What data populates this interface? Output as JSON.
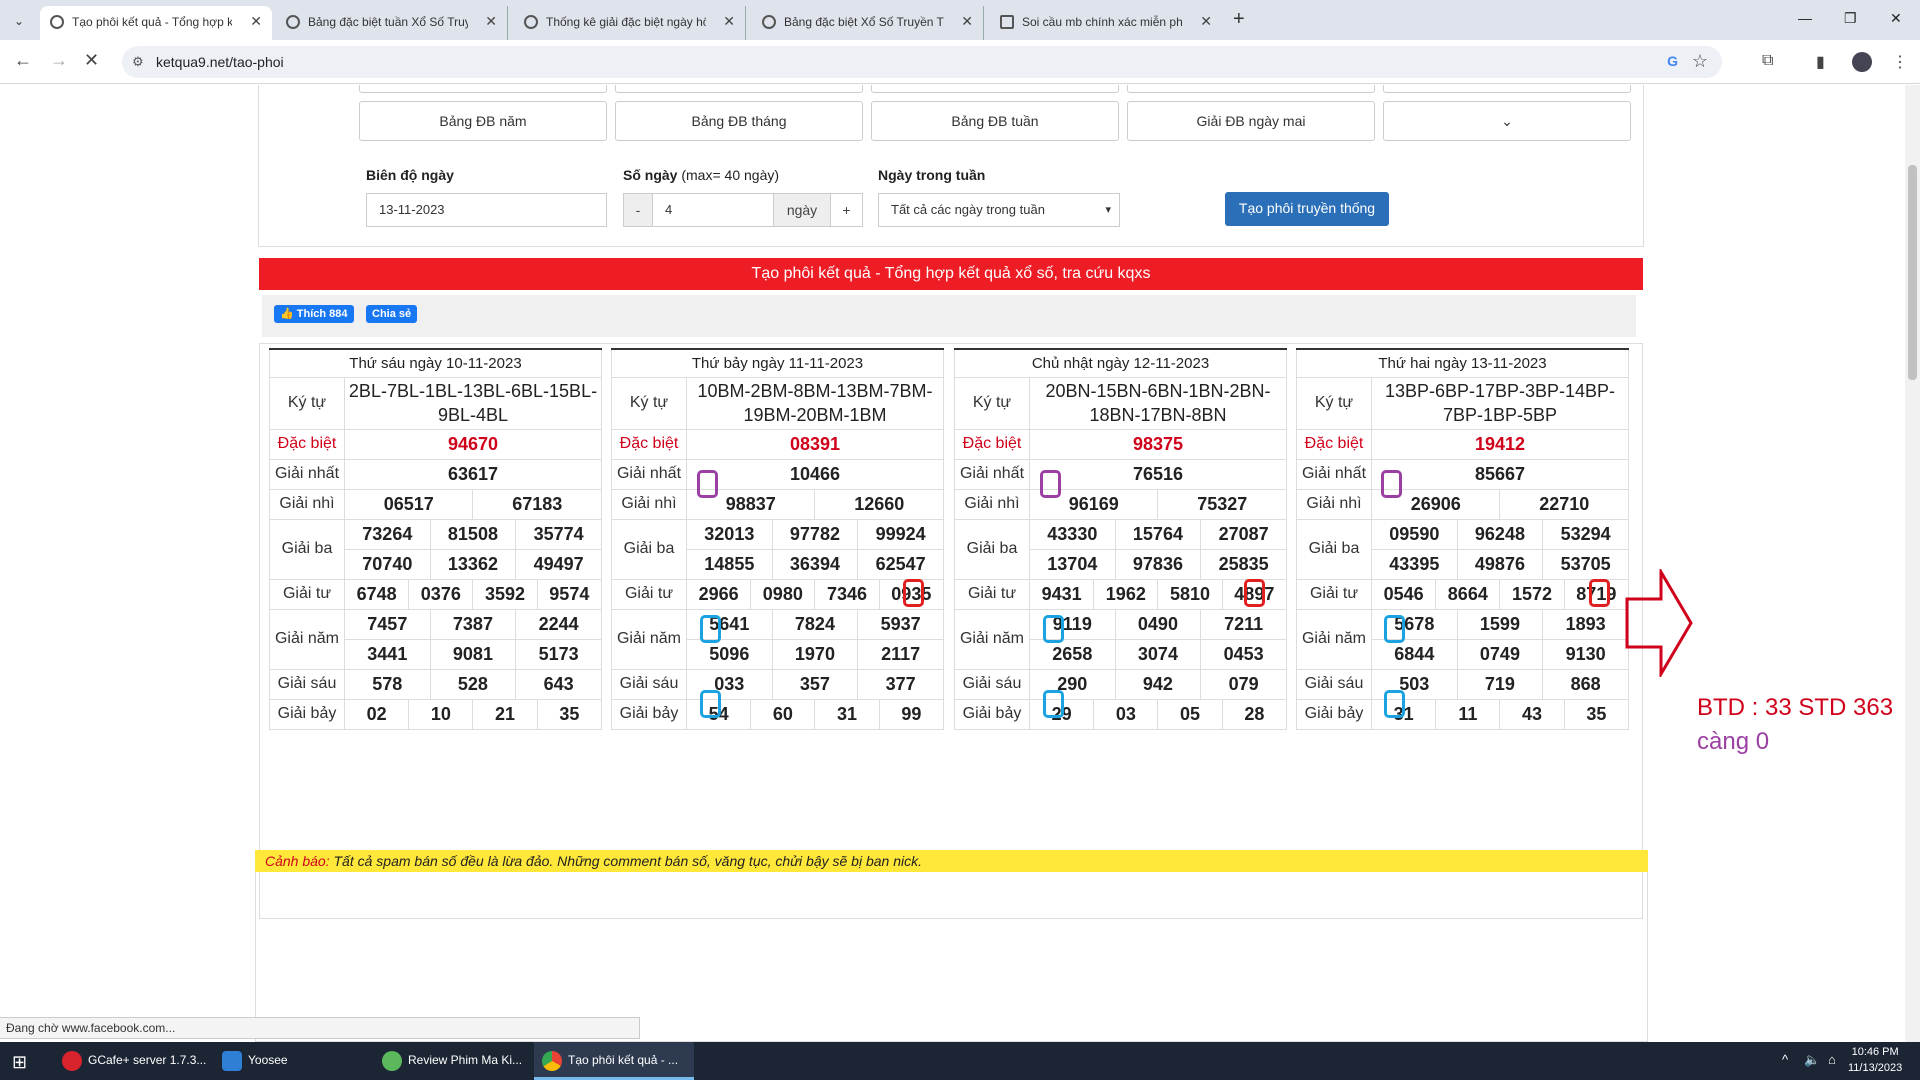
{
  "browser": {
    "tabs": [
      {
        "title": "Tạo phôi kết quả - Tổng hợp kết quả"
      },
      {
        "title": "Bảng đặc biệt tuần Xổ Số Truyền Thống"
      },
      {
        "title": "Thống kê giải đặc biệt ngày hôm nay"
      },
      {
        "title": "Bảng đặc biệt Xổ Số Truyền Thống"
      },
      {
        "title": "Soi cầu mb chính xác miễn phí"
      }
    ],
    "url": "ketqua9.net/tao-phoi"
  },
  "quick_buttons": [
    "Bảng ĐB năm",
    "Bảng ĐB tháng",
    "Bảng ĐB tuần",
    "Giải ĐB ngày mai"
  ],
  "form": {
    "date_label": "Biên độ ngày",
    "date_value": "13-11-2023",
    "days_label": "Số ngày",
    "days_hint": "(max= 40 ngày)",
    "days_minus": "-",
    "days_value": "4",
    "days_unit": "ngày",
    "days_plus": "+",
    "weekday_label": "Ngày trong tuần",
    "weekday_value": "Tất cả các ngày trong tuần",
    "submit": "Tạo phôi truyền thống"
  },
  "banner": "Tạo phôi kết quả - Tổng hợp kết quả xổ số, tra cứu kqxs",
  "share": {
    "like": "Thích 884",
    "share": "Chia sẻ"
  },
  "labels": {
    "kytu": "Ký tự",
    "db": "Đặc biệt",
    "g1": "Giải nhất",
    "g2": "Giải nhì",
    "g3": "Giải ba",
    "g4": "Giải tư",
    "g5": "Giải năm",
    "g6": "Giải sáu",
    "g7": "Giải bảy"
  },
  "results": [
    {
      "header": "Thứ sáu ngày 10-11-2023",
      "kytu": "2BL-7BL-1BL-13BL-6BL-15BL-9BL-4BL",
      "db": "94670",
      "g1": "63617",
      "g2": [
        "06517",
        "67183"
      ],
      "g3": [
        "73264",
        "81508",
        "35774",
        "70740",
        "13362",
        "49497"
      ],
      "g4": [
        "6748",
        "0376",
        "3592",
        "9574"
      ],
      "g5": [
        "7457",
        "7387",
        "2244",
        "3441",
        "9081",
        "5173"
      ],
      "g6": [
        "578",
        "528",
        "643"
      ],
      "g7": [
        "02",
        "10",
        "21",
        "35"
      ]
    },
    {
      "header": "Thứ bảy ngày 11-11-2023",
      "kytu": "10BM-2BM-8BM-13BM-7BM-19BM-20BM-1BM",
      "db": "08391",
      "g1": "10466",
      "g2": [
        "98837",
        "12660"
      ],
      "g3": [
        "32013",
        "97782",
        "99924",
        "14855",
        "36394",
        "62547"
      ],
      "g4": [
        "2966",
        "0980",
        "7346",
        "0935"
      ],
      "g5": [
        "5641",
        "7824",
        "5937",
        "5096",
        "1970",
        "2117"
      ],
      "g6": [
        "033",
        "357",
        "377"
      ],
      "g7": [
        "54",
        "60",
        "31",
        "99"
      ]
    },
    {
      "header": "Chủ nhật ngày 12-11-2023",
      "kytu": "20BN-15BN-6BN-1BN-2BN-18BN-17BN-8BN",
      "db": "98375",
      "g1": "76516",
      "g2": [
        "96169",
        "75327"
      ],
      "g3": [
        "43330",
        "15764",
        "27087",
        "13704",
        "97836",
        "25835"
      ],
      "g4": [
        "9431",
        "1962",
        "5810",
        "4897"
      ],
      "g5": [
        "9119",
        "0490",
        "7211",
        "2658",
        "3074",
        "0453"
      ],
      "g6": [
        "290",
        "942",
        "079"
      ],
      "g7": [
        "29",
        "03",
        "05",
        "28"
      ]
    },
    {
      "header": "Thứ hai ngày 13-11-2023",
      "kytu": "13BP-6BP-17BP-3BP-14BP-7BP-1BP-5BP",
      "db": "19412",
      "g1": "85667",
      "g2": [
        "26906",
        "22710"
      ],
      "g3": [
        "09590",
        "96248",
        "53294",
        "43395",
        "49876",
        "53705"
      ],
      "g4": [
        "0546",
        "8664",
        "1572",
        "8719"
      ],
      "g5": [
        "5678",
        "1599",
        "1893",
        "6844",
        "0749",
        "9130"
      ],
      "g6": [
        "503",
        "719",
        "868"
      ],
      "g7": [
        "31",
        "11",
        "43",
        "35"
      ]
    }
  ],
  "warning": {
    "prefix": "Cảnh báo:",
    "text": "Tất cả spam bán số đều là lừa đảo. Những comment bán số, văng tục, chửi bậy sẽ bị ban nick."
  },
  "annotation": {
    "line1": "BTD : 33 STD 363",
    "line2": "càng 0",
    "color1": "#d0021b",
    "color2": "#9b3fa3"
  },
  "status_text": "Đang chờ www.facebook.com...",
  "taskbar": {
    "apps": [
      "GCafe+ server 1.7.3...",
      "Yoosee",
      "Review Phim Ma Ki...",
      "Tạo phôi kết quả - ..."
    ],
    "time": "10:46 PM",
    "date": "11/13/2023"
  },
  "colors": {
    "banner": "#ee1c25",
    "primary": "#2a6fb8",
    "warning_bg": "#ffe83a",
    "highlight_purple": "#9b3fa3",
    "highlight_red": "#e02020",
    "highlight_blue": "#1aa3e0"
  }
}
